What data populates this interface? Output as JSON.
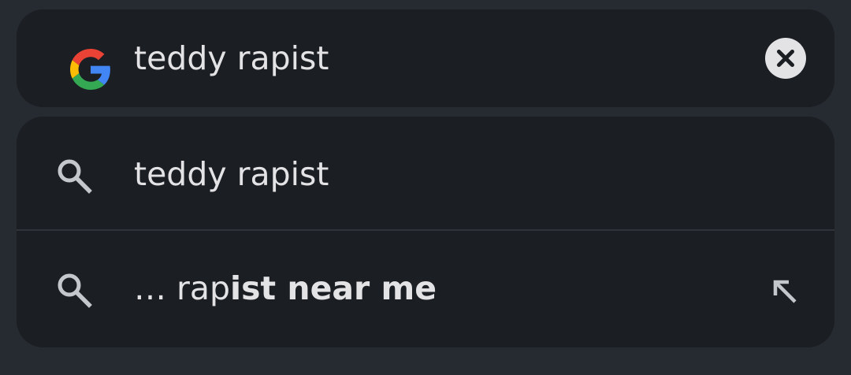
{
  "search_bar": {
    "logo_icon": "google-g-icon",
    "query": "teddy rapist",
    "clear_icon": "close-icon"
  },
  "suggestions": [
    {
      "icon": "search-icon",
      "text": "teddy rapist"
    },
    {
      "icon": "search-icon",
      "prefix": "… rap",
      "bold": "ist near me",
      "action_icon": "arrow-up-left-icon"
    }
  ],
  "colors": {
    "background": "#262a31",
    "surface": "#1b1e23",
    "text": "#e3e3e5",
    "icon": "#c4c7cc",
    "google_blue": "#4285F4",
    "google_red": "#EA4335",
    "google_yellow": "#FBBC05",
    "google_green": "#34A853"
  }
}
